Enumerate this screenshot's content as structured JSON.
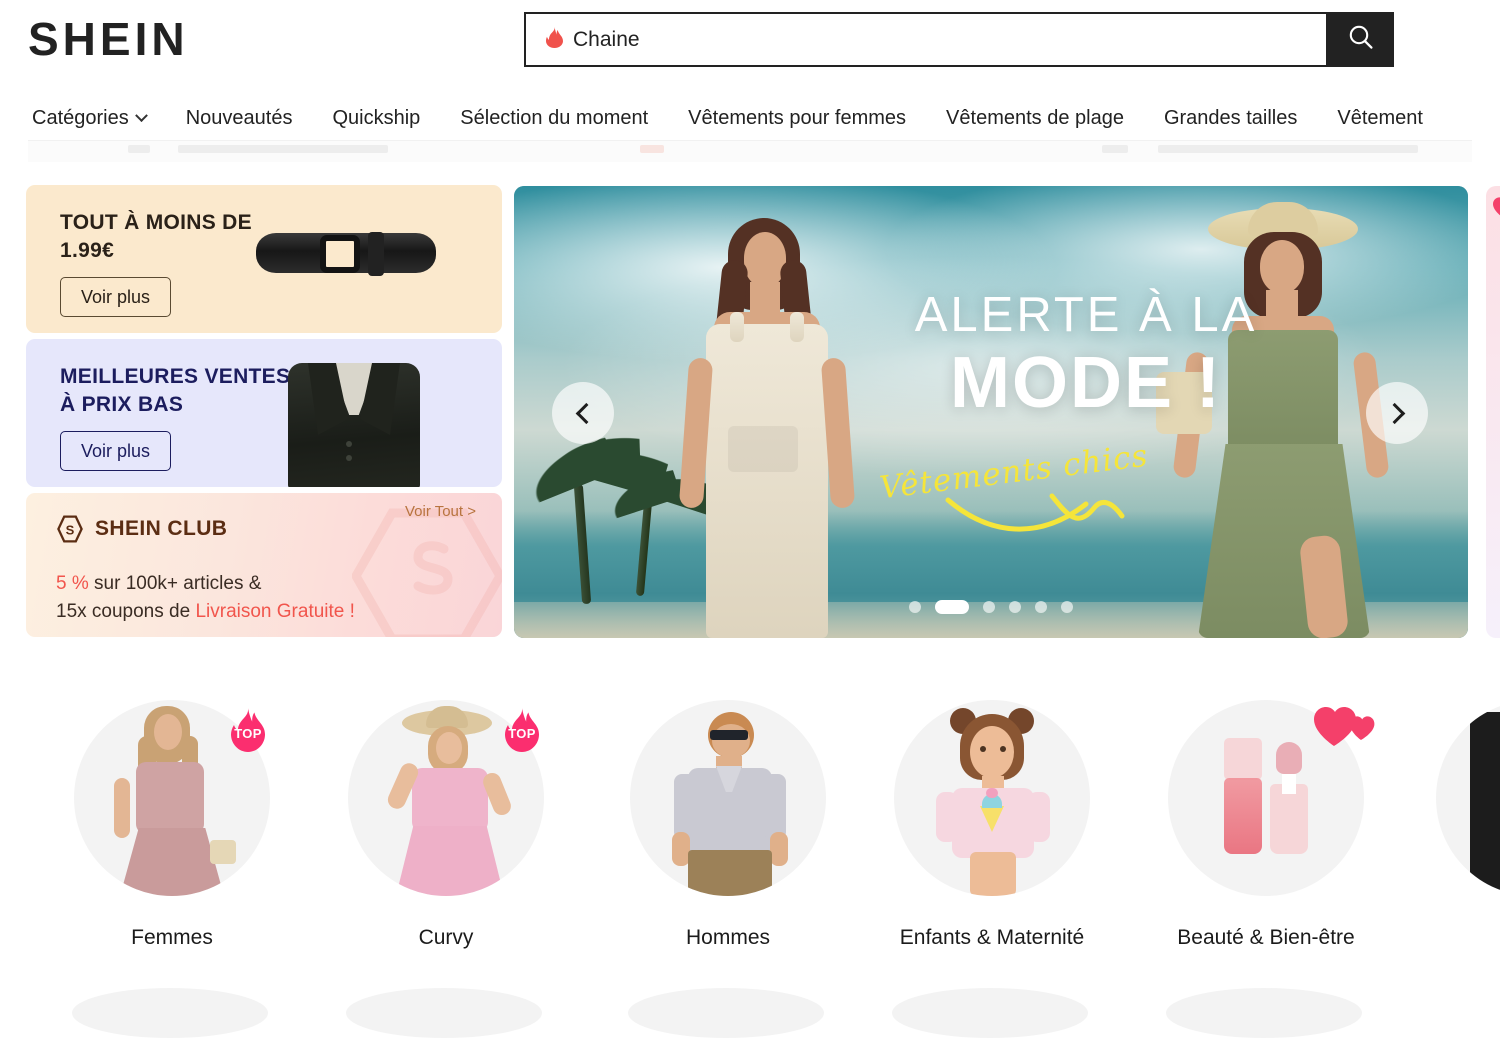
{
  "brand": {
    "logo_text": "SHEIN"
  },
  "search": {
    "icon": "flame-icon",
    "flame_glyph": "🔥",
    "value": "Chaine",
    "button_icon": "search-icon"
  },
  "nav": {
    "items": [
      {
        "label": "Catégories",
        "has_caret": true
      },
      {
        "label": "Nouveautés",
        "has_caret": false
      },
      {
        "label": "Quickship",
        "has_caret": false
      },
      {
        "label": "Sélection du moment",
        "has_caret": false
      },
      {
        "label": "Vêtements pour femmes",
        "has_caret": false
      },
      {
        "label": "Vêtements de plage",
        "has_caret": false
      },
      {
        "label": "Grandes tailles",
        "has_caret": false
      },
      {
        "label": "Vêtement",
        "has_caret": false
      }
    ]
  },
  "promos": {
    "card_1": {
      "title_line1": "TOUT À MOINS DE",
      "title_line2": "1.99€",
      "button": "Voir plus",
      "bg": "#fbe9cd",
      "image": "black-belt"
    },
    "card_2": {
      "title_line1": "MEILLEURES VENTES",
      "title_line2": "À PRIX BAS",
      "button": "Voir plus",
      "bg": "#e6e7fb",
      "image": "black-blazer"
    },
    "club": {
      "logo_icon": "shein-club-hexagon-icon",
      "name": "SHEIN CLUB",
      "see_all": "Voir Tout >",
      "line1_accent": "5 %",
      "line1_rest": " sur 100k+ articles &",
      "line2_prefix": "15x coupons de ",
      "line2_accent": "Livraison Gratuite !",
      "accent_color": "#f1554c",
      "name_color": "#5b2d13"
    }
  },
  "hero": {
    "title_line1": "ALERTE À LA",
    "title_line2": "MODE !",
    "script_text": "Vêtements chics",
    "script_color": "#f5e53a",
    "prev_icon": "chevron-left-icon",
    "next_icon": "chevron-right-icon",
    "dots_count": 6,
    "active_dot": 2
  },
  "categories": [
    {
      "label": "Femmes",
      "badge": "TOP",
      "badge_type": "flame"
    },
    {
      "label": "Curvy",
      "badge": "TOP",
      "badge_type": "flame"
    },
    {
      "label": "Hommes",
      "badge": null,
      "badge_type": null
    },
    {
      "label": "Enfants & Maternité",
      "badge": null,
      "badge_type": null
    },
    {
      "label": "Beauté & Bien-être",
      "badge": null,
      "badge_type": "heart"
    }
  ]
}
